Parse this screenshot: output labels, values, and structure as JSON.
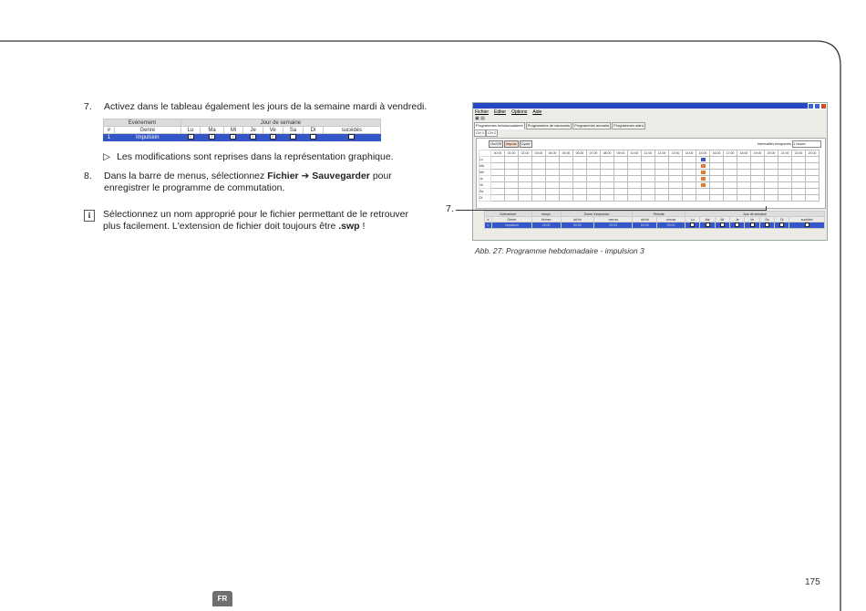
{
  "steps": [
    {
      "num": "7.",
      "text": "Activez dans le tableau également les jours de la semaine mardi à vendredi."
    },
    {
      "num": "8.",
      "text_pre": "Dans la barre de menus, sélectionnez ",
      "bold1": "Fichier",
      "arrow": "➔",
      "bold2": "Sauvegarder",
      "text_post": " pour enregistrer le programme de commutation."
    }
  ],
  "mini_table": {
    "header1": [
      "Evénement",
      "Jour de semaine"
    ],
    "header2": [
      "#",
      "Genre",
      "Lu",
      "Ma",
      "Mi",
      "Je",
      "Ve",
      "Sa",
      "Di",
      "sucédés"
    ],
    "row": {
      "num": "1",
      "genre": "Impulsion",
      "days_checked": [
        true,
        true,
        true,
        true,
        true,
        false,
        false,
        false
      ]
    }
  },
  "bullet": {
    "arrow": "▷",
    "text": "Les modifications sont reprises dans la représentation graphique."
  },
  "info": {
    "text_pre": "Sélectionnez un nom approprié pour le fichier permettant de le retrouver plus facilement. L'extension de fichier doit toujours être ",
    "bold": ".swp",
    "text_post": " !"
  },
  "screenshot": {
    "menu": [
      "Fichier",
      "Éditer",
      "Options",
      "Aide"
    ],
    "tabs": [
      "Programmes hebdomadaires",
      "Programmes de vacances",
      "Programmes annuels",
      "Programmes astro"
    ],
    "subtabs": [
      "CH 1",
      "CH 2"
    ],
    "mode_buttons": [
      "On/Off",
      "Impuls",
      "Cycle"
    ],
    "scale_label": "Intervalles temporels",
    "scale_value": "1 heure",
    "hours": [
      "00:00",
      "01:00",
      "02:00",
      "03:00",
      "04:00",
      "05:00",
      "06:00",
      "07:00",
      "08:00",
      "09:00",
      "10:00",
      "11:00",
      "12:00",
      "13:00",
      "14:00",
      "15:00",
      "16:00",
      "17:00",
      "18:00",
      "19:00",
      "20:00",
      "21:00",
      "22:00",
      "23:00"
    ],
    "days": [
      "Lu",
      "Ma",
      "Me",
      "Je",
      "Ve",
      "Sa",
      "Di"
    ],
    "event_hour_index": 15,
    "event_days": [
      true,
      true,
      true,
      true,
      true,
      false,
      false
    ],
    "lower_header1": [
      "Evénement",
      "temps",
      "Durée d'impulsion",
      "Période",
      "Jour de semaine"
    ],
    "lower_header2": [
      "#",
      "Genre",
      "hh:mm",
      "dd:hh",
      "mm:ss",
      "dd:hh",
      "mm:ss",
      "Lu",
      "Ma",
      "Mi",
      "Je",
      "Ve",
      "Sa",
      "Di",
      "sucédés"
    ],
    "lower_row": [
      "1",
      "Impulsion",
      "15:00",
      "00:00",
      "00:03",
      "00:00",
      "00:00"
    ]
  },
  "callout": "7.",
  "caption": "Abb. 27:  Programme hebdomadaire - impulsion 3",
  "page_number": "175",
  "language_tab": "FR"
}
